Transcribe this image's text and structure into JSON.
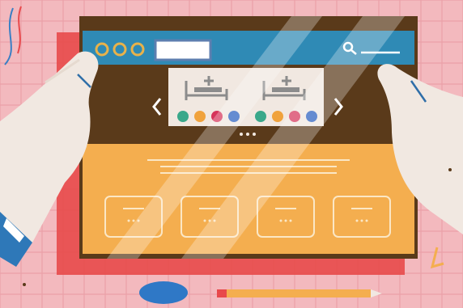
{
  "illustration": {
    "browser": {
      "window_dots": 3,
      "carousel_slides": [
        {
          "badges": [
            {
              "color": "#3aa88a"
            },
            {
              "color": "#f0a23c"
            },
            {
              "color": "#d6345a"
            },
            {
              "color": "#2a5fbf"
            }
          ]
        },
        {
          "badges": [
            {
              "color": "#3aa88a"
            },
            {
              "color": "#f0a23c"
            },
            {
              "color": "#d6345a"
            },
            {
              "color": "#2a5fbf"
            }
          ]
        }
      ],
      "pager_dots": 3,
      "feature_cards": 4
    },
    "colors": {
      "background": "#f3b9be",
      "grid": "#e89ca3",
      "frame": "#5a3a1a",
      "header": "#2f8ab5",
      "hero": "#5a3a1a",
      "content": "#f4ae4f",
      "card_outline": "#fbe7c5",
      "hands": "#f1e8e1",
      "shadow": "#e84a4a"
    },
    "icons": [
      "bed-plus-icon",
      "search-icon",
      "chevron-left-icon",
      "chevron-right-icon"
    ]
  }
}
